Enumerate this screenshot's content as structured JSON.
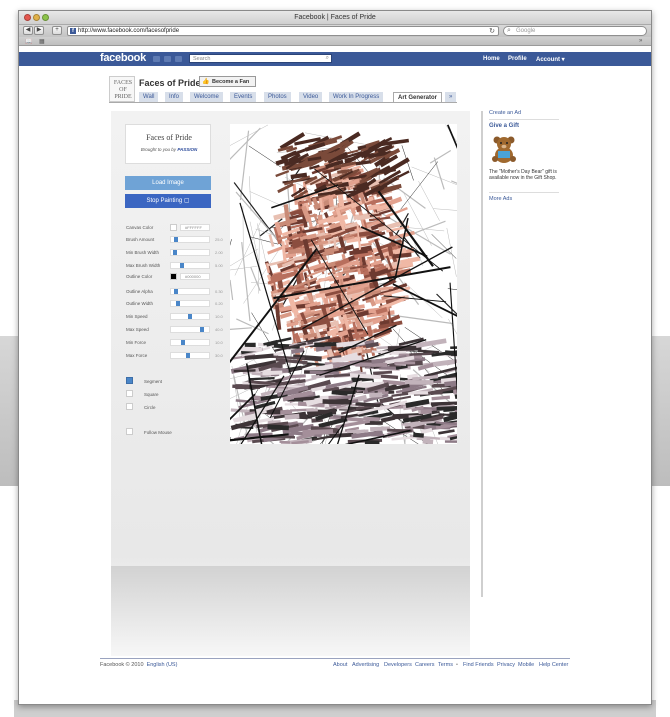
{
  "browser": {
    "window_title": "Facebook | Faces of Pride",
    "url": "http://www.facebook.com/facesofpride",
    "search_placeholder": "Google"
  },
  "facebook": {
    "logo": "facebook",
    "search_placeholder": "Search",
    "top_links": [
      "Home",
      "Profile",
      "Account ▾"
    ]
  },
  "page": {
    "logo_text": [
      "FACES",
      "OF",
      "PRIDE"
    ],
    "name": "Faces of Pride",
    "fan_button": "Become a Fan",
    "tabs": [
      "Wall",
      "Info",
      "Welcome",
      "Events",
      "Photos",
      "Video",
      "Work In Progress",
      "Art Generator"
    ],
    "tabs_more": "»",
    "active_tab": "Art Generator"
  },
  "app": {
    "brand_title": "Faces of Pride",
    "brand_sub_prefix": "Brought to you by",
    "brand_sub_name": "PASSION",
    "load_button": "Load Image",
    "stop_button": "Stop Painting",
    "controls": [
      {
        "label": "Canvas Color",
        "type": "color",
        "color": "#ffffff",
        "value": "#FFFFFF"
      },
      {
        "label": "Brush Amount",
        "type": "slider",
        "pos": 0.1,
        "value": "25.0"
      },
      {
        "label": "Min Brush Width",
        "type": "slider",
        "pos": 0.05,
        "value": "2.00"
      },
      {
        "label": "Max Brush Width",
        "type": "slider",
        "pos": 0.25,
        "value": "5.00"
      },
      {
        "label": "Outline Color",
        "type": "color",
        "color": "#000000",
        "value": "#000000"
      },
      {
        "label": "Outline Alpha",
        "type": "slider",
        "pos": 0.1,
        "value": "0.30"
      },
      {
        "label": "Outline Width",
        "type": "slider",
        "pos": 0.15,
        "value": "0.20"
      },
      {
        "label": "Min Speed",
        "type": "slider",
        "pos": 0.5,
        "value": "10.0"
      },
      {
        "label": "Max Speed",
        "type": "slider",
        "pos": 0.85,
        "value": "40.0"
      },
      {
        "label": "Min Force",
        "type": "slider",
        "pos": 0.3,
        "value": "10.0"
      },
      {
        "label": "Max Force",
        "type": "slider",
        "pos": 0.45,
        "value": "30.0"
      }
    ],
    "checkboxes": [
      {
        "label": "Segment",
        "checked": true
      },
      {
        "label": "Square",
        "checked": false
      },
      {
        "label": "Circle",
        "checked": false
      }
    ],
    "follow_mouse": "Follow Mouse"
  },
  "right_column": {
    "create_ad": "Create an Ad",
    "gift_title": "Give a Gift",
    "gift_text": "The \"Mother's Day Bear\" gift is available now in the Gift Shop.",
    "more_ads": "More Ads"
  },
  "footer": {
    "copyright": "Facebook © 2010",
    "language": "English (US)",
    "links": [
      "About",
      "Advertising",
      "Developers",
      "Careers",
      "Terms",
      "•",
      "Find Friends",
      "Privacy",
      "Mobile",
      "Help Center"
    ]
  }
}
